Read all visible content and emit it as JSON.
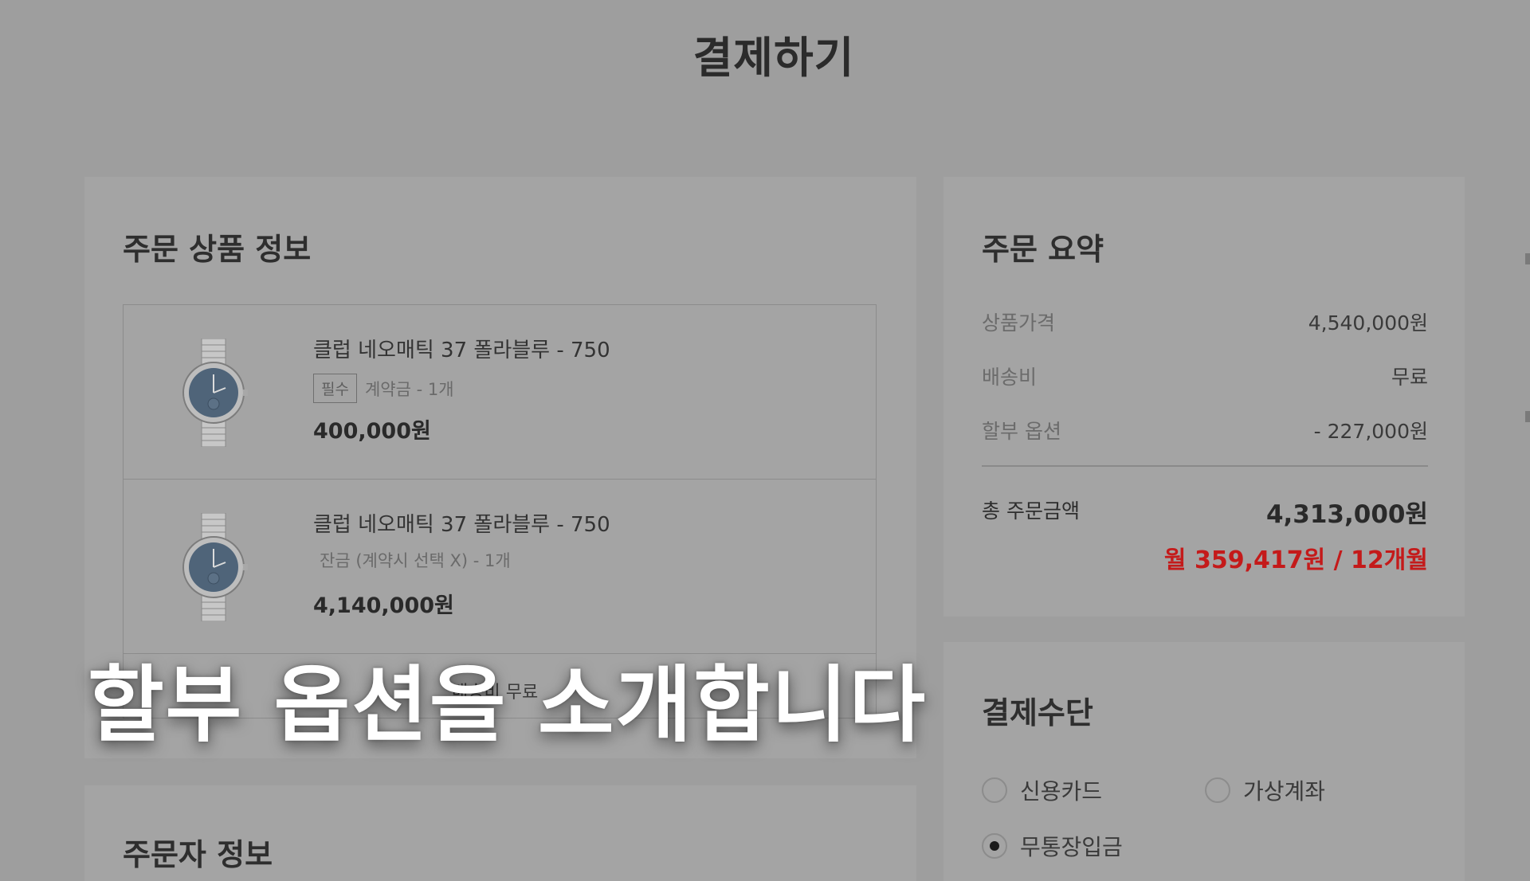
{
  "page": {
    "title": "결제하기"
  },
  "order_products": {
    "title": "주문 상품 정보",
    "items": [
      {
        "name": "클럽 네오매틱 37 폴라블루 - 750",
        "tag": "필수",
        "option": "계약금 - 1개",
        "price": "400,000원",
        "image_icon": "watch-image"
      },
      {
        "name": "클럽 네오매틱 37 폴라블루 - 750",
        "tag": "",
        "option": "잔금 (계약시 선택 X) - 1개",
        "price": "4,140,000원",
        "image_icon": "watch-image"
      }
    ],
    "shipping_text": "배송비 무료"
  },
  "orderer": {
    "title": "주문자 정보"
  },
  "summary": {
    "title": "주문 요약",
    "rows": [
      {
        "label": "상품가격",
        "value": "4,540,000원"
      },
      {
        "label": "배송비",
        "value": "무료"
      },
      {
        "label": "할부 옵션",
        "value": "- 227,000원"
      }
    ],
    "total_label": "총 주문금액",
    "total_value": "4,313,000원",
    "monthly": "월 359,417원 / 12개월",
    "accent_color": "#c41a1a"
  },
  "payment": {
    "title": "결제수단",
    "options": [
      {
        "label": "신용카드",
        "selected": false
      },
      {
        "label": "가상계좌",
        "selected": false
      },
      {
        "label": "무통장입금",
        "selected": true
      }
    ]
  },
  "caption": "할부 옵션을 소개합니다"
}
